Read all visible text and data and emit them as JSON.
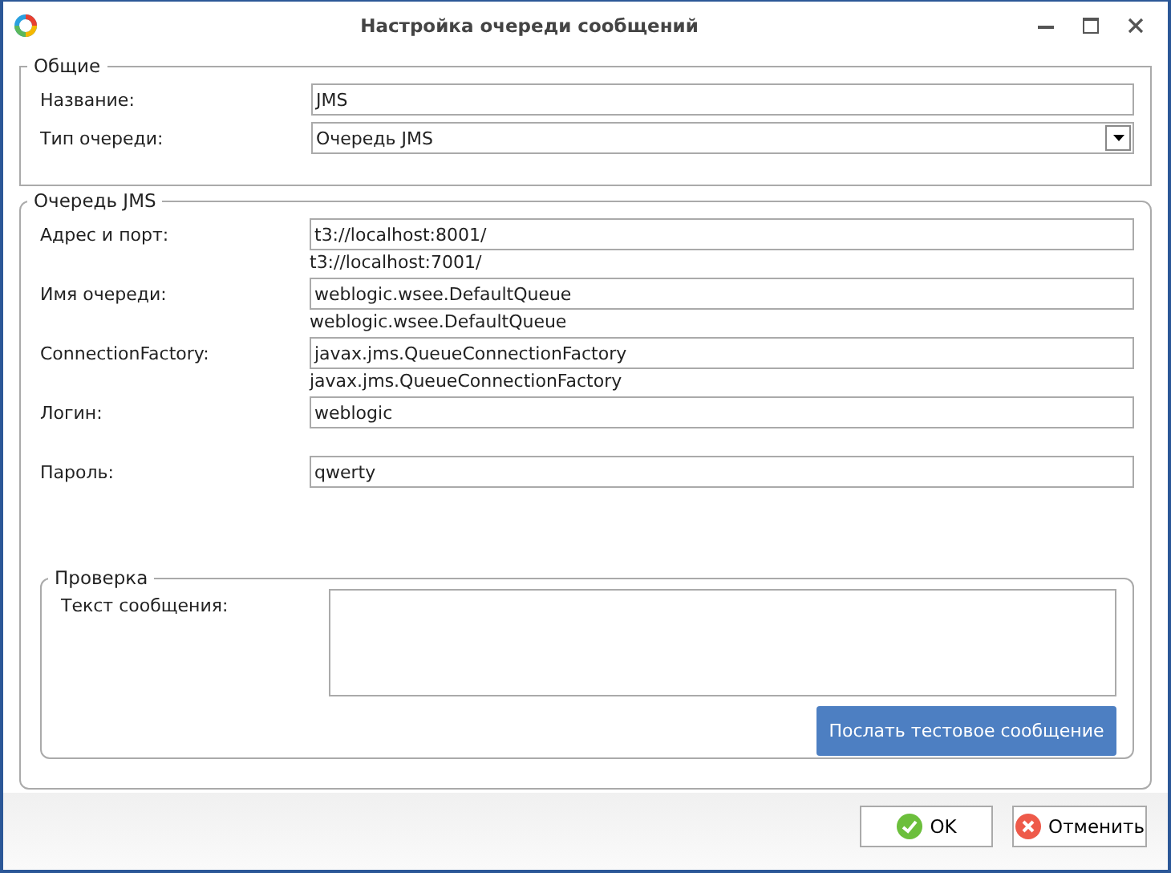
{
  "window": {
    "title": "Настройка очереди сообщений"
  },
  "general": {
    "title": "Общие",
    "fields": [
      {
        "kind": "text",
        "label": "Название:",
        "value": "JMS"
      },
      {
        "kind": "select",
        "label": "Тип очереди:",
        "value": "Очередь JMS"
      }
    ]
  },
  "jms": {
    "title": "Очередь JMS",
    "fields": [
      {
        "label": "Адрес и порт:",
        "value": "t3://localhost:8001/",
        "note": "t3://localhost:7001/"
      },
      {
        "label": "Имя очереди:",
        "value": "weblogic.wsee.DefaultQueue",
        "note": "weblogic.wsee.DefaultQueue"
      },
      {
        "label": "ConnectionFactory:",
        "value": "javax.jms.QueueConnectionFactory",
        "note": "javax.jms.QueueConnectionFactory"
      },
      {
        "label": "Логин:",
        "value": "weblogic"
      },
      {
        "label": "Пароль:",
        "value": "qwerty"
      }
    ]
  },
  "test": {
    "title": "Проверка",
    "label": "Текст сообщения:",
    "button": "Послать тестовое сообщение"
  },
  "buttons": [
    {
      "kind": "ok",
      "label": "OK"
    },
    {
      "kind": "cancel",
      "label": "Отменить"
    }
  ]
}
